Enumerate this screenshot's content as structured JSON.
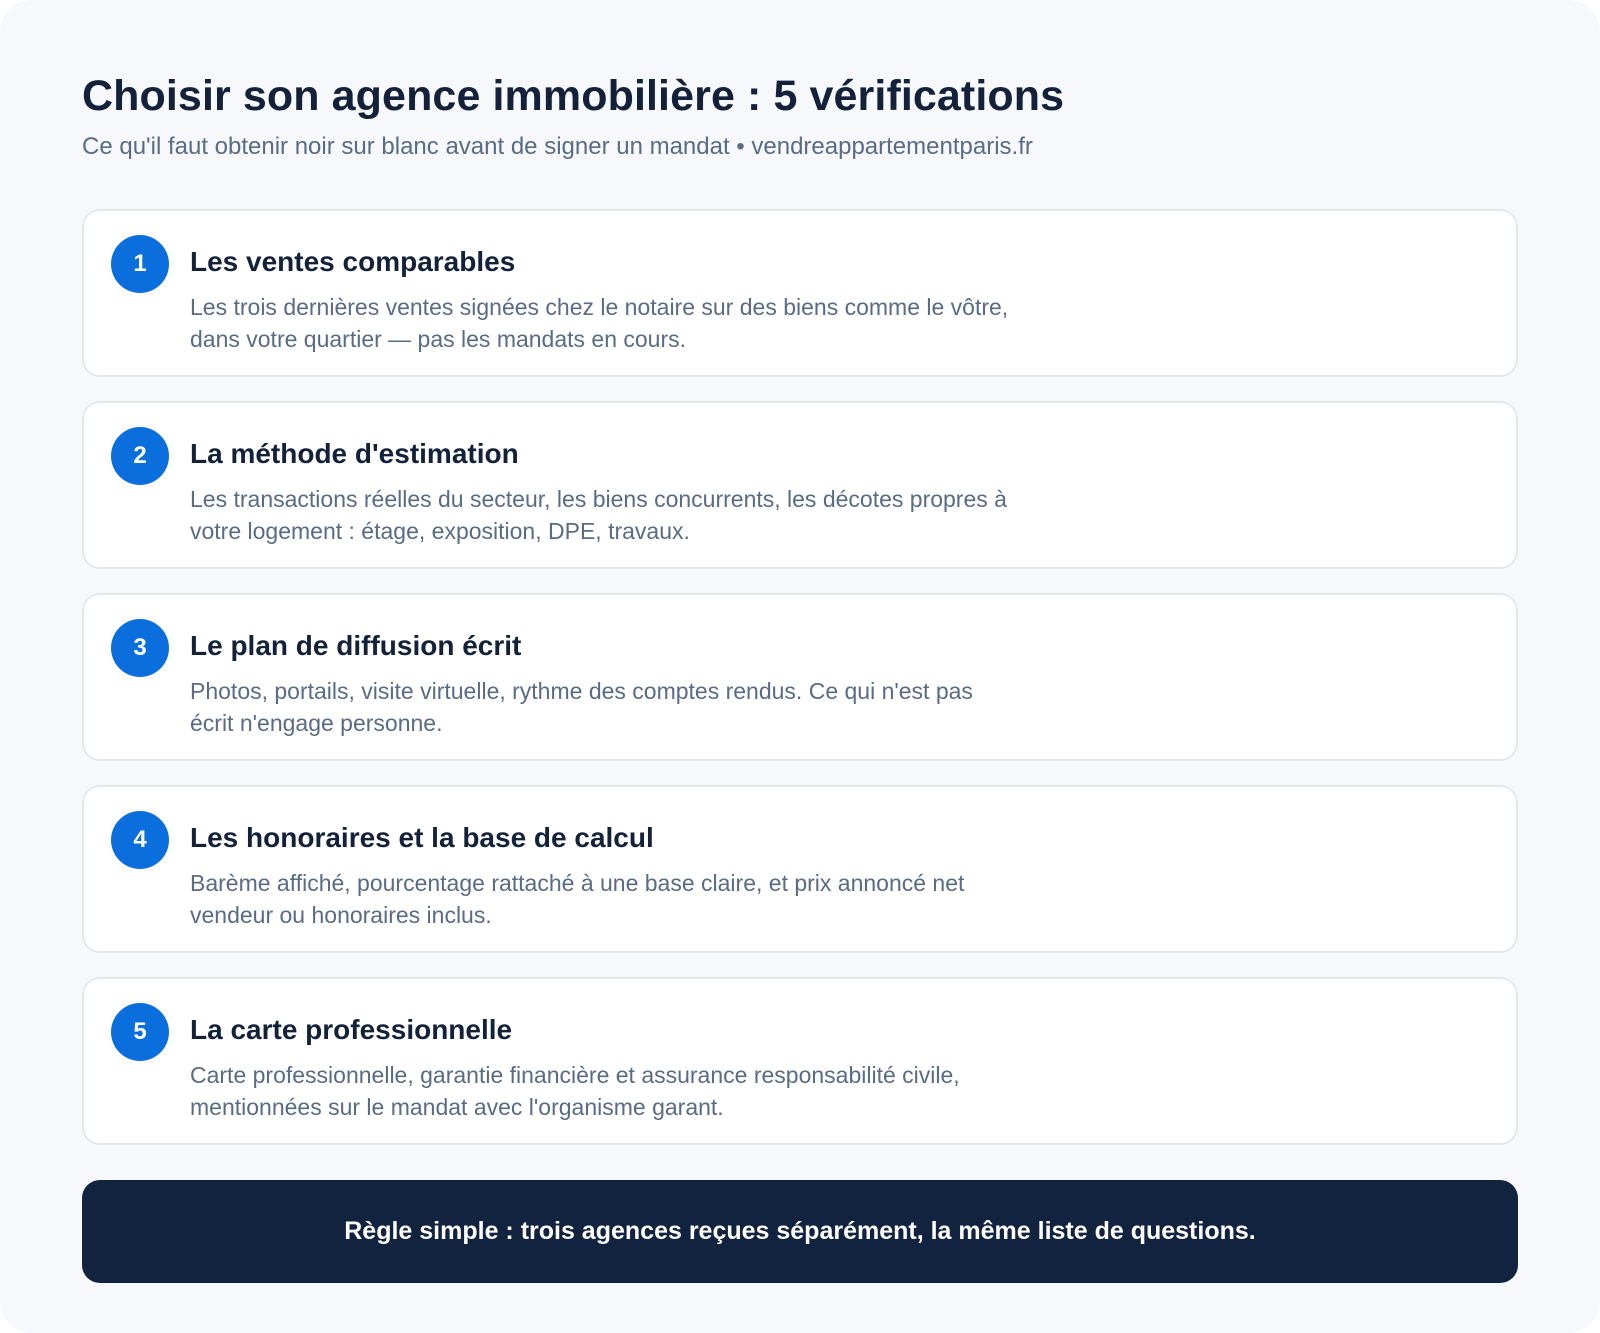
{
  "header": {
    "title": "Choisir son agence immobilière : 5 vérifications",
    "subtitle": "Ce qu'il faut obtenir noir sur blanc avant de signer un mandat • vendreappartementparis.fr"
  },
  "items": [
    {
      "number": "1",
      "title": "Les ventes comparables",
      "description": "Les trois dernières ventes signées chez le notaire sur des biens comme le vôtre, dans votre quartier — pas les mandats en cours."
    },
    {
      "number": "2",
      "title": "La méthode d'estimation",
      "description": "Les transactions réelles du secteur, les biens concurrents, les décotes propres à votre logement : étage, exposition, DPE, travaux."
    },
    {
      "number": "3",
      "title": "Le plan de diffusion écrit",
      "description": "Photos, portails, visite virtuelle, rythme des comptes rendus. Ce qui n'est pas écrit n'engage personne."
    },
    {
      "number": "4",
      "title": "Les honoraires et la base de calcul",
      "description": "Barème affiché, pourcentage rattaché à une base claire, et prix annoncé net vendeur ou honoraires inclus."
    },
    {
      "number": "5",
      "title": "La carte professionnelle",
      "description": "Carte professionnelle, garantie financière et assurance responsabilité civile, mentionnées sur le mandat avec l'organisme garant."
    }
  ],
  "footer": {
    "rule": "Règle simple : trois agences reçues séparément, la même liste de questions."
  },
  "colors": {
    "accent": "#0a6fdc",
    "heading": "#13213a",
    "muted": "#5a6b85",
    "banner": "#12233f"
  }
}
